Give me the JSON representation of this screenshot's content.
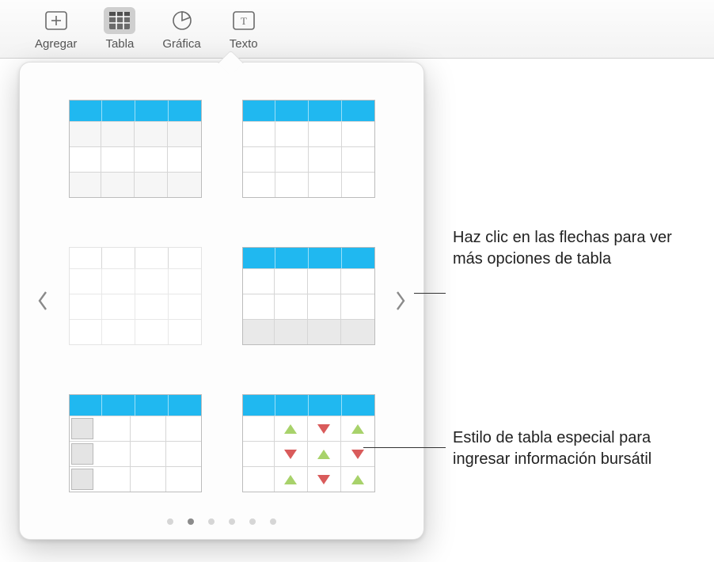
{
  "toolbar": {
    "items": [
      {
        "label": "Agregar",
        "icon": "plus-box"
      },
      {
        "label": "Tabla",
        "icon": "table-grid",
        "active": true
      },
      {
        "label": "Gráfica",
        "icon": "pie"
      },
      {
        "label": "Texto",
        "icon": "text-box"
      }
    ]
  },
  "popover": {
    "arrows": {
      "prev": "previous-page",
      "next": "next-page"
    },
    "table_styles": [
      {
        "id": "style-blue-header-alt",
        "desc": "Blue header, alternating rows, 4 cols"
      },
      {
        "id": "style-blue-header-plain",
        "desc": "Blue header, plain rows, 4 cols"
      },
      {
        "id": "style-borderless",
        "desc": "No borders, light grid"
      },
      {
        "id": "style-header-footer",
        "desc": "Blue header with footer row"
      },
      {
        "id": "style-row-headers",
        "desc": "Blue header with row header buttons"
      },
      {
        "id": "style-stock",
        "desc": "Stock tracking table with up/down indicators"
      }
    ],
    "pager": {
      "count": 6,
      "active_index": 1
    }
  },
  "callouts": {
    "arrows_hint": "Haz clic en las flechas para ver más opciones de tabla",
    "stock_hint": "Estilo de tabla especial para ingresar información bursátil"
  },
  "colors": {
    "accent": "#20b8f0",
    "tri_up": "#a8d26b",
    "tri_down": "#d95b5b"
  }
}
